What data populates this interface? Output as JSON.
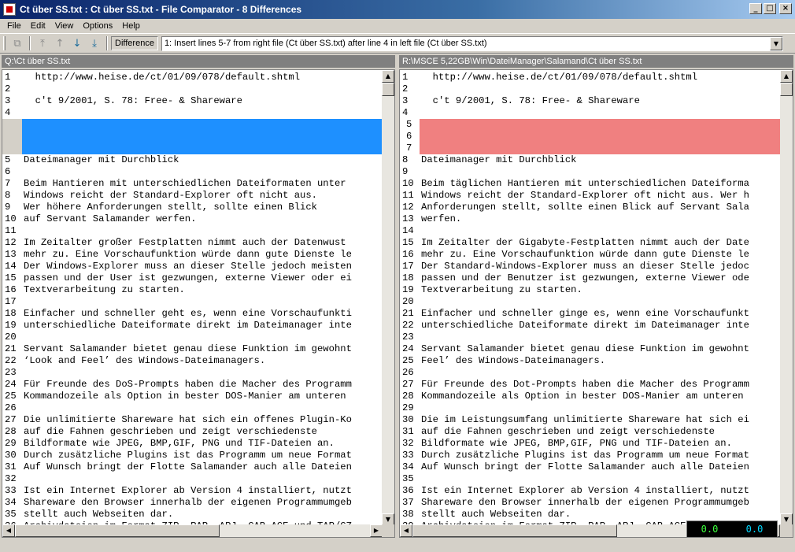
{
  "window": {
    "title": "Ct über SS.txt : Ct über SS.txt - File Comparator - 8 Differences"
  },
  "menu": [
    "File",
    "Edit",
    "View",
    "Options",
    "Help"
  ],
  "toolbar": {
    "difference_label": "Difference",
    "difference_value": "1: Insert lines 5-7 from right file (Ct über SS.txt) after line 4 in left file (Ct über SS.txt)"
  },
  "left": {
    "path": "Q:\\Ct über SS.txt",
    "top_lines": [
      {
        "n": "1",
        "t": "  http://www.heise.de/ct/01/09/078/default.shtml"
      },
      {
        "n": "2",
        "t": ""
      },
      {
        "n": "3",
        "t": "  c't 9/2001, S. 78: Free- & Shareware"
      },
      {
        "n": "4",
        "t": ""
      }
    ],
    "lines": [
      {
        "n": "5",
        "t": "Dateimanager mit Durchblick"
      },
      {
        "n": "6",
        "t": ""
      },
      {
        "n": "7",
        "t": "Beim Hantieren mit unterschiedlichen Dateiformaten unter"
      },
      {
        "n": "8",
        "t": "Windows reicht der Standard-Explorer oft nicht aus."
      },
      {
        "n": "9",
        "t": "Wer höhere Anforderungen stellt, sollte einen Blick"
      },
      {
        "n": "10",
        "t": "auf Servant Salamander werfen."
      },
      {
        "n": "11",
        "t": ""
      },
      {
        "n": "12",
        "t": "Im Zeitalter großer Festplatten nimmt auch der Datenwust"
      },
      {
        "n": "13",
        "t": "mehr zu. Eine Vorschaufunktion würde dann gute Dienste le"
      },
      {
        "n": "14",
        "t": "Der Windows-Explorer muss an dieser Stelle jedoch meisten"
      },
      {
        "n": "15",
        "t": "passen und der User ist gezwungen, externe Viewer oder ei"
      },
      {
        "n": "16",
        "t": "Textverarbeitung zu starten."
      },
      {
        "n": "17",
        "t": ""
      },
      {
        "n": "18",
        "t": "Einfacher und schneller geht es, wenn eine Vorschaufunkti"
      },
      {
        "n": "19",
        "t": "unterschiedliche Dateiformate direkt im Dateimanager inte"
      },
      {
        "n": "20",
        "t": ""
      },
      {
        "n": "21",
        "t": "Servant Salamander bietet genau diese Funktion im gewohnt"
      },
      {
        "n": "22",
        "t": "‘Look and Feel’ des Windows-Dateimanagers."
      },
      {
        "n": "23",
        "t": ""
      },
      {
        "n": "24",
        "t": "Für Freunde des DoS-Prompts haben die Macher des Programm"
      },
      {
        "n": "25",
        "t": "Kommandozeile als Option in bester DOS-Manier am unteren"
      },
      {
        "n": "26",
        "t": ""
      },
      {
        "n": "27",
        "t": "Die unlimitierte Shareware hat sich ein offenes Plugin-Ko"
      },
      {
        "n": "28",
        "t": "auf die Fahnen geschrieben und zeigt verschiedenste"
      },
      {
        "n": "29",
        "t": "Bildformate wie JPEG, BMP,GIF, PNG und TIF-Dateien an."
      },
      {
        "n": "30",
        "t": "Durch zusätzliche Plugins ist das Programm um neue Format"
      },
      {
        "n": "31",
        "t": "Auf Wunsch bringt der Flotte Salamander auch alle Dateien"
      },
      {
        "n": "32",
        "t": ""
      },
      {
        "n": "33",
        "t": "Ist ein Internet Explorer ab Version 4 installiert, nutzt"
      },
      {
        "n": "34",
        "t": "Shareware den Browser innerhalb der eigenen Programmumgeb"
      },
      {
        "n": "35",
        "t": "stellt auch Webseiten dar."
      },
      {
        "n": "36",
        "t": "Archivdateien im Format ZIP, RAR, ARJ, CAB,ACE und TAR/GZ"
      }
    ]
  },
  "right": {
    "path": "R:\\MSCE 5,22GB\\Win\\DateiManager\\Salamand\\Ct über SS.txt",
    "top_lines": [
      {
        "n": "1",
        "t": "  http://www.heise.de/ct/01/09/078/default.shtml"
      },
      {
        "n": "2",
        "t": ""
      },
      {
        "n": "3",
        "t": "  c't 9/2001, S. 78: Free- & Shareware"
      },
      {
        "n": "4",
        "t": ""
      }
    ],
    "inserted": [
      "5",
      "6",
      "7"
    ],
    "lines": [
      {
        "n": "8",
        "t": "Dateimanager mit Durchblick"
      },
      {
        "n": "9",
        "t": ""
      },
      {
        "n": "10",
        "t": "Beim täglichen Hantieren mit unterschiedlichen Dateiforma"
      },
      {
        "n": "11",
        "t": "Windows reicht der Standard-Explorer oft nicht aus. Wer h"
      },
      {
        "n": "12",
        "t": "Anforderungen stellt, sollte einen Blick auf Servant Sala"
      },
      {
        "n": "13",
        "t": "werfen."
      },
      {
        "n": "14",
        "t": ""
      },
      {
        "n": "15",
        "t": "Im Zeitalter der Gigabyte-Festplatten nimmt auch der Date"
      },
      {
        "n": "16",
        "t": "mehr zu. Eine Vorschaufunktion würde dann gute Dienste le"
      },
      {
        "n": "17",
        "t": "Der Standard-Windows-Explorer muss an dieser Stelle jedoc"
      },
      {
        "n": "18",
        "t": "passen und der Benutzer ist gezwungen, externe Viewer ode"
      },
      {
        "n": "19",
        "t": "Textverarbeitung zu starten."
      },
      {
        "n": "20",
        "t": ""
      },
      {
        "n": "21",
        "t": "Einfacher und schneller ginge es, wenn eine Vorschaufunkt"
      },
      {
        "n": "22",
        "t": "unterschiedliche Dateiformate direkt im Dateimanager inte"
      },
      {
        "n": "23",
        "t": ""
      },
      {
        "n": "24",
        "t": "Servant Salamander bietet genau diese Funktion im gewohnt"
      },
      {
        "n": "25",
        "t": "Feel’ des Windows-Dateimanagers."
      },
      {
        "n": "26",
        "t": ""
      },
      {
        "n": "27",
        "t": "Für Freunde des Dot-Prompts haben die Macher des Programm"
      },
      {
        "n": "28",
        "t": "Kommandozeile als Option in bester DOS-Manier am unteren"
      },
      {
        "n": "29",
        "t": ""
      },
      {
        "n": "30",
        "t": "Die im Leistungsumfang unlimitierte Shareware hat sich ei"
      },
      {
        "n": "31",
        "t": "auf die Fahnen geschrieben und zeigt verschiedenste"
      },
      {
        "n": "32",
        "t": "Bildformate wie JPEG, BMP,GIF, PNG und TIF-Dateien an."
      },
      {
        "n": "33",
        "t": "Durch zusätzliche Plugins ist das Programm um neue Format"
      },
      {
        "n": "34",
        "t": "Auf Wunsch bringt der Flotte Salamander auch alle Dateien"
      },
      {
        "n": "35",
        "t": ""
      },
      {
        "n": "36",
        "t": "Ist ein Internet Explorer ab Version 4 installiert, nutzt"
      },
      {
        "n": "37",
        "t": "Shareware den Browser innerhalb der eigenen Programmumgeb"
      },
      {
        "n": "38",
        "t": "stellt auch Webseiten dar."
      },
      {
        "n": "39",
        "t": "Archivdateien im Format ZIP, RAR, ARJ, CAB,ACE und TAR/GZ"
      }
    ]
  },
  "meter": {
    "a": "0.0",
    "b": "0.0"
  },
  "colors": {
    "left_diff": "#1e90ff",
    "right_diff": "#f08080",
    "left_word": "#b8d8ff",
    "right_word": "#ffc8c8"
  }
}
